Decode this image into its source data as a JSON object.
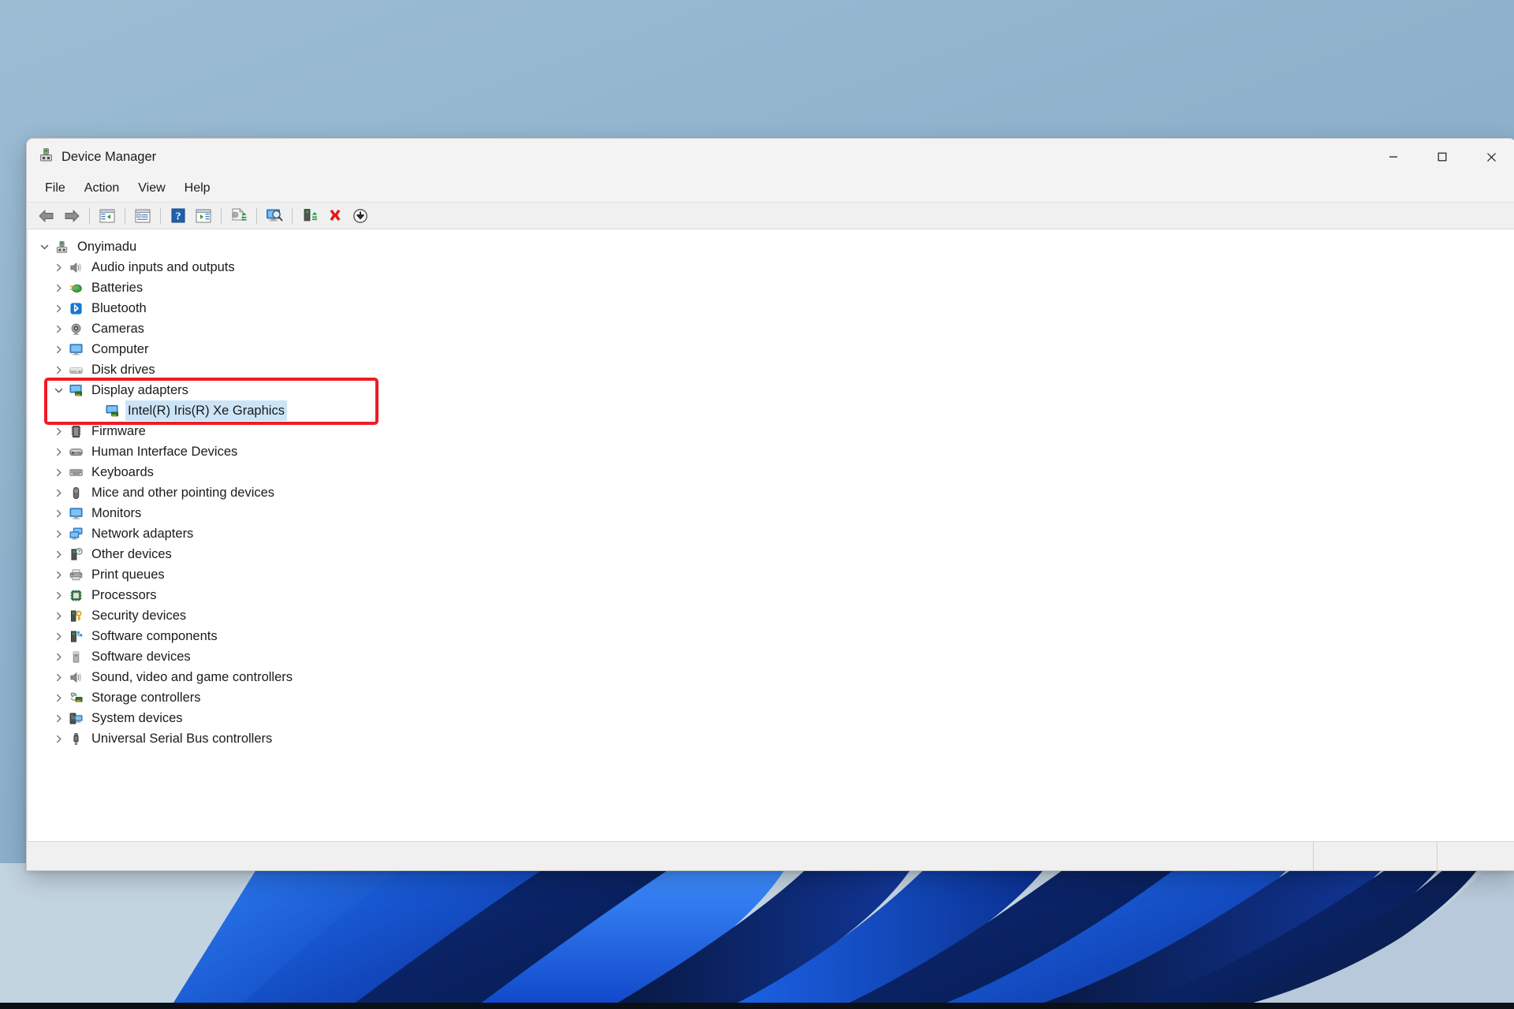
{
  "desktop": {
    "wallpaper_name": "windows-bloom-wallpaper",
    "bg_color": "#8fb3cd"
  },
  "window": {
    "title": "Device Manager",
    "app_icon": "device-manager-icon",
    "controls": {
      "minimize_label": "Minimize",
      "maximize_label": "Maximize",
      "close_label": "Close"
    }
  },
  "menubar": {
    "items": [
      {
        "label": "File",
        "name": "menu-file"
      },
      {
        "label": "Action",
        "name": "menu-action"
      },
      {
        "label": "View",
        "name": "menu-view"
      },
      {
        "label": "Help",
        "name": "menu-help"
      }
    ]
  },
  "toolbar": {
    "buttons": [
      {
        "icon": "back-arrow-icon",
        "tooltip": "Back"
      },
      {
        "icon": "forward-arrow-icon",
        "tooltip": "Forward"
      },
      {
        "icon": "show-hide-console-tree-icon",
        "tooltip": "Show/Hide Console Tree"
      },
      {
        "icon": "properties-icon",
        "tooltip": "Properties"
      },
      {
        "icon": "help-icon",
        "tooltip": "Help"
      },
      {
        "icon": "show-hide-action-pane-icon",
        "tooltip": "Show/Hide Action Pane"
      },
      {
        "icon": "update-driver-icon",
        "tooltip": "Update driver"
      },
      {
        "icon": "scan-for-hardware-changes-icon",
        "tooltip": "Scan for hardware changes"
      },
      {
        "icon": "enable-device-icon",
        "tooltip": "Enable device"
      },
      {
        "icon": "uninstall-device-icon",
        "tooltip": "Uninstall device"
      },
      {
        "icon": "disable-device-icon",
        "tooltip": "Disable device"
      }
    ]
  },
  "tree": {
    "root": {
      "label": "Onyimadu",
      "icon": "computer-root-icon",
      "expanded": true,
      "twisty": "chevron-down"
    },
    "nodes": [
      {
        "label": "Audio inputs and outputs",
        "icon": "speaker-icon",
        "level": 1,
        "twisty": "chevron-right",
        "selected": false
      },
      {
        "label": "Batteries",
        "icon": "battery-icon",
        "level": 1,
        "twisty": "chevron-right",
        "selected": false
      },
      {
        "label": "Bluetooth",
        "icon": "bluetooth-icon",
        "level": 1,
        "twisty": "chevron-right",
        "selected": false
      },
      {
        "label": "Cameras",
        "icon": "camera-icon",
        "level": 1,
        "twisty": "chevron-right",
        "selected": false
      },
      {
        "label": "Computer",
        "icon": "monitor-icon",
        "level": 1,
        "twisty": "chevron-right",
        "selected": false
      },
      {
        "label": "Disk drives",
        "icon": "disk-drive-icon",
        "level": 1,
        "twisty": "chevron-right",
        "selected": false
      },
      {
        "label": "Display adapters",
        "icon": "display-adapter-icon",
        "level": 1,
        "twisty": "chevron-down",
        "selected": false,
        "highlighted": true
      },
      {
        "label": "Intel(R) Iris(R) Xe Graphics",
        "icon": "display-adapter-icon",
        "level": 2,
        "twisty": "none",
        "selected": true,
        "highlighted": true
      },
      {
        "label": "Firmware",
        "icon": "firmware-chip-icon",
        "level": 1,
        "twisty": "chevron-right",
        "selected": false
      },
      {
        "label": "Human Interface Devices",
        "icon": "gamepad-icon",
        "level": 1,
        "twisty": "chevron-right",
        "selected": false
      },
      {
        "label": "Keyboards",
        "icon": "keyboard-icon",
        "level": 1,
        "twisty": "chevron-right",
        "selected": false
      },
      {
        "label": "Mice and other pointing devices",
        "icon": "mouse-icon",
        "level": 1,
        "twisty": "chevron-right",
        "selected": false
      },
      {
        "label": "Monitors",
        "icon": "monitor-icon",
        "level": 1,
        "twisty": "chevron-right",
        "selected": false
      },
      {
        "label": "Network adapters",
        "icon": "network-adapter-icon",
        "level": 1,
        "twisty": "chevron-right",
        "selected": false
      },
      {
        "label": "Other devices",
        "icon": "unknown-device-icon",
        "level": 1,
        "twisty": "chevron-right",
        "selected": false
      },
      {
        "label": "Print queues",
        "icon": "printer-icon",
        "level": 1,
        "twisty": "chevron-right",
        "selected": false
      },
      {
        "label": "Processors",
        "icon": "processor-icon",
        "level": 1,
        "twisty": "chevron-right",
        "selected": false
      },
      {
        "label": "Security devices",
        "icon": "security-key-icon",
        "level": 1,
        "twisty": "chevron-right",
        "selected": false
      },
      {
        "label": "Software components",
        "icon": "software-component-icon",
        "level": 1,
        "twisty": "chevron-right",
        "selected": false
      },
      {
        "label": "Software devices",
        "icon": "software-device-icon",
        "level": 1,
        "twisty": "chevron-right",
        "selected": false
      },
      {
        "label": "Sound, video and game controllers",
        "icon": "speaker-icon",
        "level": 1,
        "twisty": "chevron-right",
        "selected": false
      },
      {
        "label": "Storage controllers",
        "icon": "storage-controller-icon",
        "level": 1,
        "twisty": "chevron-right",
        "selected": false
      },
      {
        "label": "System devices",
        "icon": "system-device-icon",
        "level": 1,
        "twisty": "chevron-right",
        "selected": false
      },
      {
        "label": "Universal Serial Bus controllers",
        "icon": "usb-icon",
        "level": 1,
        "twisty": "chevron-right",
        "selected": false
      }
    ]
  },
  "annotation": {
    "highlight_color": "#ee1c25",
    "target_label": "Display adapters"
  },
  "statusbar": {
    "message": "",
    "pane1": "",
    "pane2": ""
  },
  "colors": {
    "selection": "#cce4f7",
    "window_bg": "#f3f3f3",
    "tree_bg": "#ffffff",
    "accent_red": "#ee1c25"
  }
}
